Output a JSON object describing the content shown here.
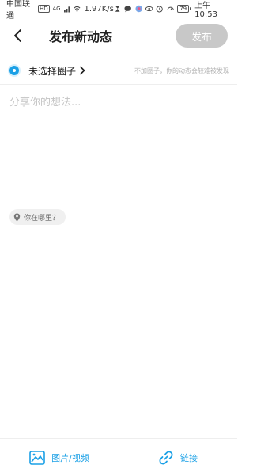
{
  "statusbar": {
    "carrier": "中国联通",
    "hd_badge": "HD",
    "net_type": "4G",
    "speed": "1.97K/s",
    "battery": "79",
    "time": "上午10:53"
  },
  "header": {
    "title": "发布新动态",
    "publish_label": "发布"
  },
  "circle": {
    "label": "未选择圈子",
    "hint": "不加圈子，你的动态会较难被发现"
  },
  "composer": {
    "placeholder": "分享你的想法..."
  },
  "location": {
    "label": "你在哪里？"
  },
  "bottom_bar": {
    "media_label": "图片/视频",
    "link_label": "链接"
  },
  "colors": {
    "accent": "#1aa0e6",
    "publish_disabled": "#c8c8c8"
  }
}
